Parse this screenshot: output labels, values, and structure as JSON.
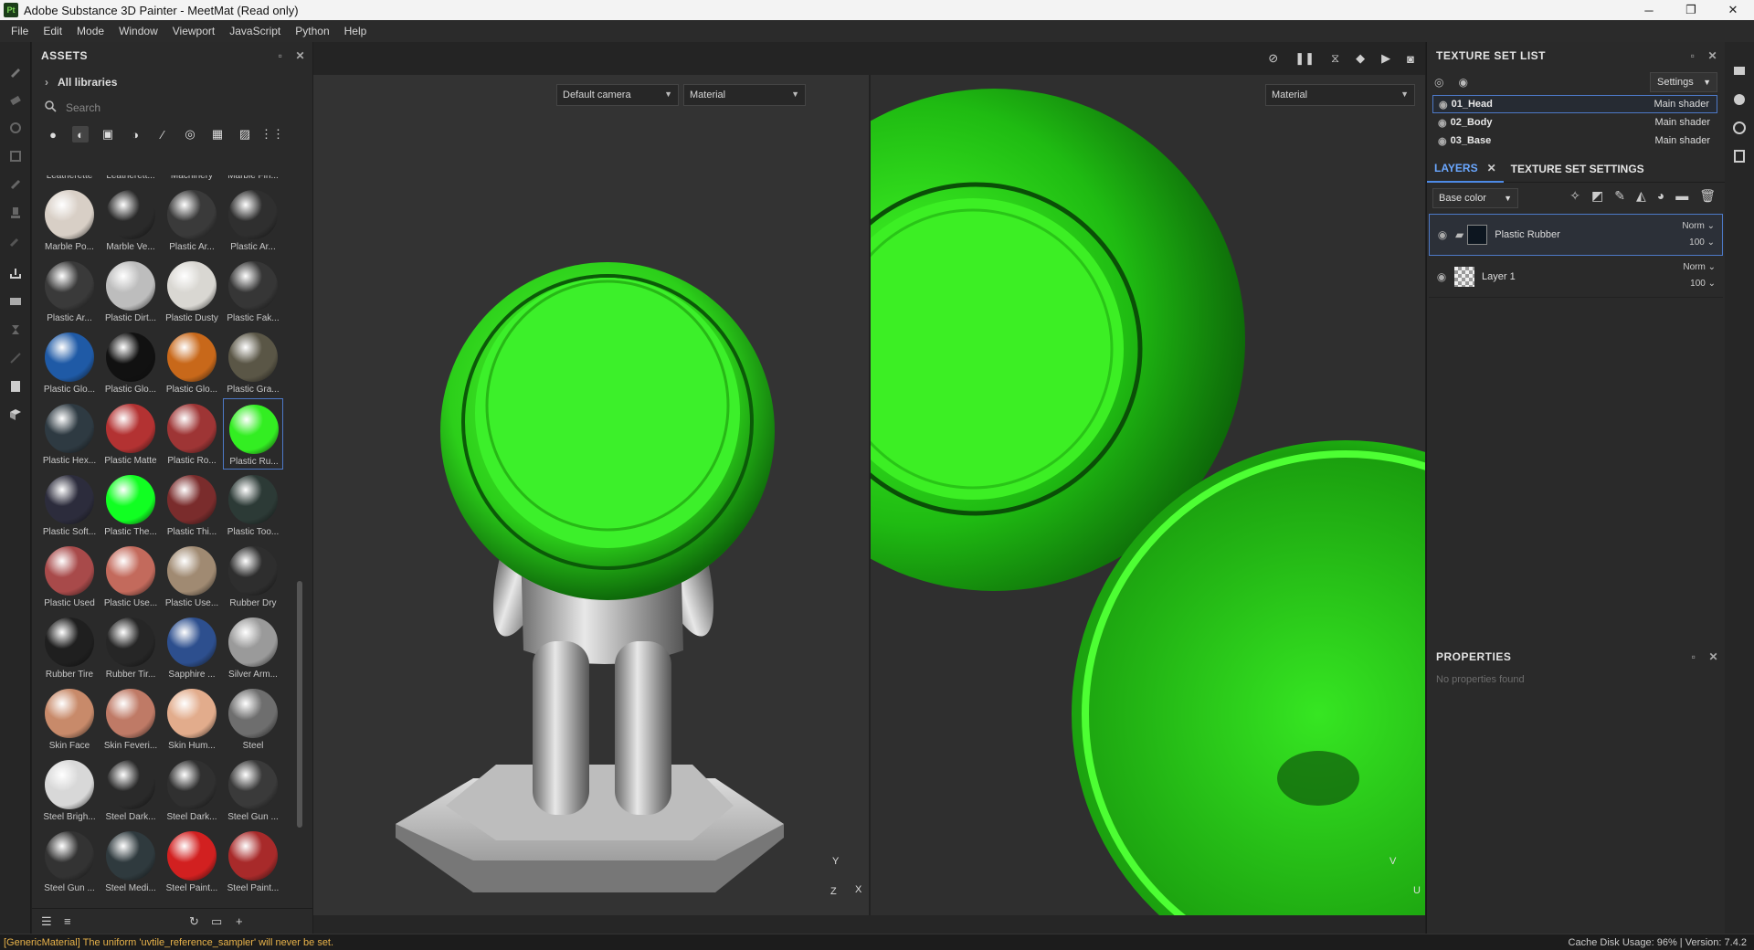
{
  "window": {
    "title": "Adobe Substance 3D Painter - MeetMat (Read only)",
    "app_badge": "Pt",
    "controls": {
      "minimize": "─",
      "restore": "❐",
      "close": "✕"
    }
  },
  "menu": [
    "File",
    "Edit",
    "Mode",
    "Window",
    "Viewport",
    "JavaScript",
    "Python",
    "Help"
  ],
  "assets": {
    "title": "ASSETS",
    "library": "All libraries",
    "search_placeholder": "Search",
    "materials": [
      {
        "label": "Leatherette",
        "color": "#6a4e3c"
      },
      {
        "label": "Leatherett...",
        "color": "#4a3a2e"
      },
      {
        "label": "Machinery",
        "color": "#c08a2c"
      },
      {
        "label": "Marble Fin...",
        "color": "#8a8a8a"
      },
      {
        "label": "Marble Po...",
        "color": "#d8cfc6"
      },
      {
        "label": "Marble Ve...",
        "color": "#2a2a2a"
      },
      {
        "label": "Plastic Ar...",
        "color": "#3a3a3a"
      },
      {
        "label": "Plastic Ar...",
        "color": "#2f2f2f"
      },
      {
        "label": "Plastic Ar...",
        "color": "#3a3a3a"
      },
      {
        "label": "Plastic Dirt...",
        "color": "#bdbdbd"
      },
      {
        "label": "Plastic Dusty",
        "color": "#d9d7d2"
      },
      {
        "label": "Plastic Fak...",
        "color": "#363636"
      },
      {
        "label": "Plastic Glo...",
        "color": "#1f5aa6"
      },
      {
        "label": "Plastic Glo...",
        "color": "#111111"
      },
      {
        "label": "Plastic Glo...",
        "color": "#c8681a"
      },
      {
        "label": "Plastic Gra...",
        "color": "#5a5646"
      },
      {
        "label": "Plastic Hex...",
        "color": "#2e3a42"
      },
      {
        "label": "Plastic Matte",
        "color": "#b33232"
      },
      {
        "label": "Plastic Ro...",
        "color": "#9e3535"
      },
      {
        "label": "Plastic Ru...",
        "color": "#33ee22"
      },
      {
        "label": "Plastic Soft...",
        "color": "#2c2c3c"
      },
      {
        "label": "Plastic The...",
        "color": "#11ff22"
      },
      {
        "label": "Plastic Thi...",
        "color": "#7a2c2c"
      },
      {
        "label": "Plastic Too...",
        "color": "#2c3a36"
      },
      {
        "label": "Plastic Used",
        "color": "#a84a4a"
      },
      {
        "label": "Plastic Use...",
        "color": "#c36a5c"
      },
      {
        "label": "Plastic Use...",
        "color": "#a08a72"
      },
      {
        "label": "Rubber Dry",
        "color": "#2e2e2e"
      },
      {
        "label": "Rubber Tire",
        "color": "#1f1f1f"
      },
      {
        "label": "Rubber Tir...",
        "color": "#262626"
      },
      {
        "label": "Sapphire ...",
        "color": "#2d4f8e"
      },
      {
        "label": "Silver Arm...",
        "color": "#9a9a9a"
      },
      {
        "label": "Skin Face",
        "color": "#c88a6a"
      },
      {
        "label": "Skin Feveri...",
        "color": "#bf7a66"
      },
      {
        "label": "Skin Hum...",
        "color": "#e2ac8c"
      },
      {
        "label": "Steel",
        "color": "#6e6e6e"
      },
      {
        "label": "Steel Brigh...",
        "color": "#d8d8d8"
      },
      {
        "label": "Steel Dark...",
        "color": "#2a2a2a"
      },
      {
        "label": "Steel Dark...",
        "color": "#303030"
      },
      {
        "label": "Steel Gun ...",
        "color": "#3a3a3a"
      },
      {
        "label": "Steel Gun ...",
        "color": "#333333"
      },
      {
        "label": "Steel Medi...",
        "color": "#2f3a3e"
      },
      {
        "label": "Steel Paint...",
        "color": "#d22020"
      },
      {
        "label": "Steel Paint...",
        "color": "#a82a2a"
      }
    ],
    "selected_material": "Plastic Ru..."
  },
  "viewport": {
    "camera_dropdown": "Default camera",
    "mode_3d_dropdown": "Material",
    "mode_2d_dropdown": "Material",
    "axis_3d": {
      "y": "Y",
      "x": "X",
      "z": "Z"
    },
    "axis_2d": {
      "v": "V",
      "u": "U"
    }
  },
  "texture_set_list": {
    "title": "TEXTURE SET LIST",
    "settings_label": "Settings",
    "sets": [
      {
        "name": "01_Head",
        "shader": "Main shader"
      },
      {
        "name": "02_Body",
        "shader": "Main shader"
      },
      {
        "name": "03_Base",
        "shader": "Main shader"
      }
    ]
  },
  "layers": {
    "tab_layers": "LAYERS",
    "tab_settings": "TEXTURE SET SETTINGS",
    "channel": "Base color",
    "items": [
      {
        "name": "Plastic Rubber",
        "blend": "Norm",
        "opacity": "100"
      },
      {
        "name": "Layer 1",
        "blend": "Norm",
        "opacity": "100"
      }
    ]
  },
  "properties": {
    "title": "PROPERTIES",
    "empty": "No properties found"
  },
  "status": {
    "message": "[GenericMaterial] The uniform 'uvtile_reference_sampler' will never be set.",
    "right": "Cache Disk Usage:  96% | Version: 7.4.2"
  },
  "colors": {
    "accent": "#4d79c7",
    "mat_green": "#33ee22",
    "warning": "#e9b34a"
  }
}
